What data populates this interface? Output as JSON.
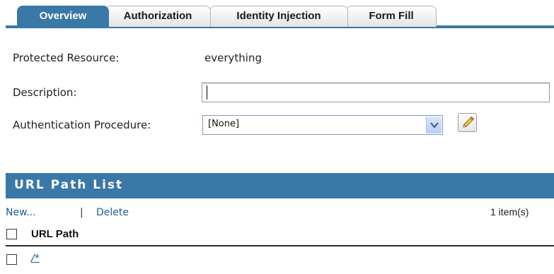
{
  "tabs": [
    {
      "label": "Overview",
      "active": true
    },
    {
      "label": "Authorization",
      "active": false
    },
    {
      "label": "Identity Injection",
      "active": false
    },
    {
      "label": "Form Fill",
      "active": false
    }
  ],
  "form": {
    "protected_resource_label": "Protected Resource:",
    "protected_resource_value": "everything",
    "description_label": "Description:",
    "description_value": "",
    "auth_procedure_label": "Authentication Procedure:",
    "auth_procedure_selected": "[None]"
  },
  "icons": {
    "dropdown": "chevron-down-icon",
    "edit": "pencil-icon"
  },
  "url_list": {
    "title": "URL Path List",
    "new_label": "New...",
    "separator": "|",
    "delete_label": "Delete",
    "count": "1 item(s)",
    "column_header": "URL Path",
    "rows": [
      {
        "path": "/*"
      }
    ]
  },
  "colors": {
    "accent": "#3a78a8",
    "link": "#1f5d96"
  }
}
